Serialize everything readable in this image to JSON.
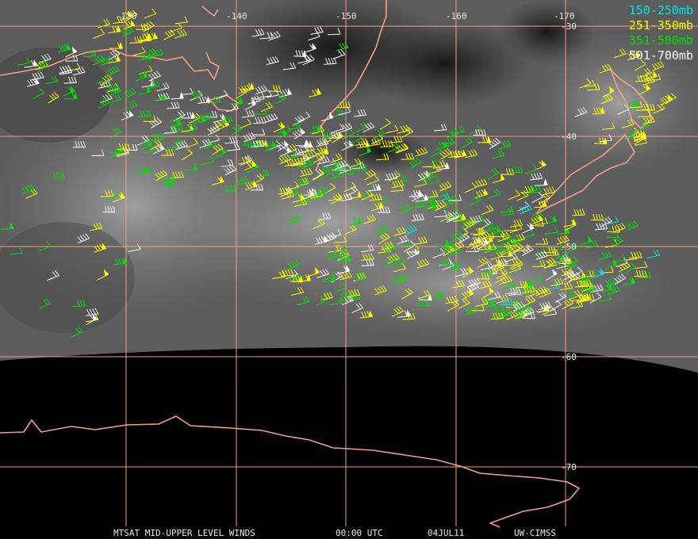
{
  "legend": [
    {
      "label": "150-250mb",
      "color": "#00e5e5"
    },
    {
      "label": "251-350mb",
      "color": "#ffff00"
    },
    {
      "label": "351-500mb",
      "color": "#00e000"
    },
    {
      "label": "501-700mb",
      "color": "#ffffff"
    }
  ],
  "longitude_labels": [
    "-130",
    "-140",
    "-150",
    "-160",
    "-170"
  ],
  "latitude_labels": [
    "-30",
    "-40",
    "-50",
    "-60",
    "-70"
  ],
  "footer": {
    "product": "MTSAT MID-UPPER LEVEL WINDS",
    "time": "00:00 UTC",
    "date": "04JUL11",
    "source": "UW-CIMSS"
  },
  "colors": {
    "grid": "#f0a080",
    "coast": "#f4a080",
    "background": "#000000"
  }
}
